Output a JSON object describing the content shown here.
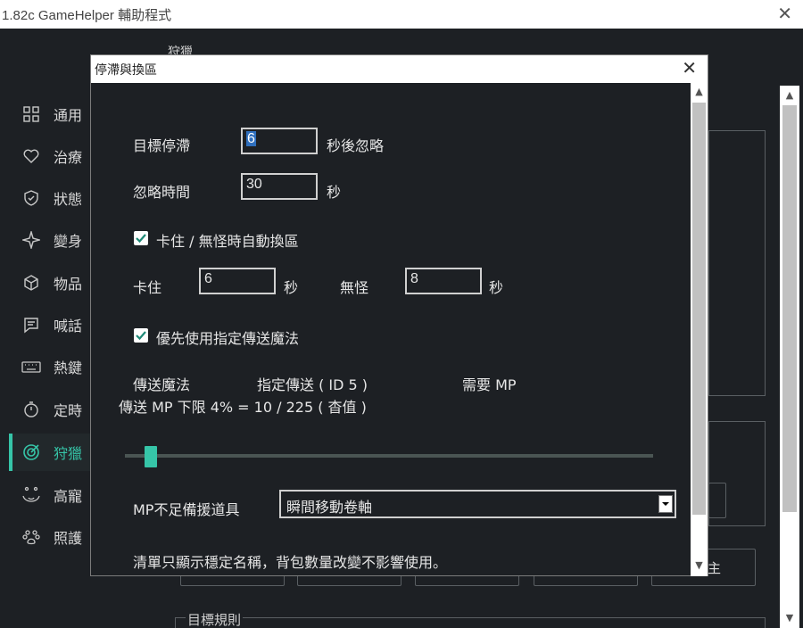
{
  "window": {
    "title": "1.82c GameHelper 輔助程式",
    "close_glyph": "✕"
  },
  "nav": {
    "items": [
      {
        "label": "通用",
        "icon": "grid-icon"
      },
      {
        "label": "治療",
        "icon": "heart-icon"
      },
      {
        "label": "狀態",
        "icon": "shield-icon"
      },
      {
        "label": "變身",
        "icon": "sparkle-icon"
      },
      {
        "label": "物品",
        "icon": "cube-icon"
      },
      {
        "label": "喊話",
        "icon": "chat-icon"
      },
      {
        "label": "熱鍵",
        "icon": "keyboard-icon"
      },
      {
        "label": "定時",
        "icon": "timer-icon"
      },
      {
        "label": "狩獵",
        "icon": "target-icon",
        "active": true
      },
      {
        "label": "高寵",
        "icon": "pet-face-icon"
      },
      {
        "label": "照護",
        "icon": "paw-icon"
      }
    ]
  },
  "background": {
    "section_title": "狩獵",
    "group_label": "目標規則",
    "partial_button_text": "主"
  },
  "dialog": {
    "title": "停滯與換區",
    "close_glyph": "✕",
    "target_stall": {
      "label": "目標停滯",
      "value": "6",
      "suffix": "秒後忽略"
    },
    "ignore_time": {
      "label": "忽略時間",
      "value": "30",
      "suffix": "秒"
    },
    "auto_switch": {
      "checked": true,
      "label": "卡住 / 無怪時自動換區"
    },
    "stuck": {
      "label": "卡住",
      "value": "6",
      "unit": "秒"
    },
    "no_monster": {
      "label": "無怪",
      "value": "8",
      "unit": "秒"
    },
    "prefer_teleport": {
      "checked": true,
      "label": "優先使用指定傳送魔法"
    },
    "teleport_magic_label": "傳送魔法",
    "teleport_spec": "指定傳送 ( ID 5 )",
    "mp_required_label": "需要 MP",
    "mp_limit_text": "傳送 MP 下限  4% = 10 / 225 ( 杳值 )",
    "mp_limit_percent": 4,
    "mp_item_label": "MP不足備援道具",
    "mp_item_value": "瞬間移動卷軸",
    "note": "清單只顯示穩定名稱，背包數量改變不影響使用。"
  }
}
